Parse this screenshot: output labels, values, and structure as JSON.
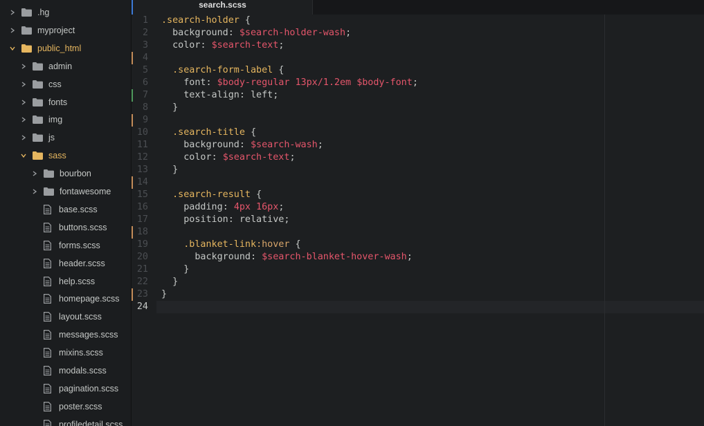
{
  "tree": {
    "items": [
      {
        "label": ".hg",
        "kind": "folder",
        "expanded": false,
        "depth": 0
      },
      {
        "label": "myproject",
        "kind": "folder",
        "expanded": false,
        "depth": 0
      },
      {
        "label": "public_html",
        "kind": "folder",
        "expanded": true,
        "depth": 0
      },
      {
        "label": "admin",
        "kind": "folder",
        "expanded": false,
        "depth": 1
      },
      {
        "label": "css",
        "kind": "folder",
        "expanded": false,
        "depth": 1
      },
      {
        "label": "fonts",
        "kind": "folder",
        "expanded": false,
        "depth": 1
      },
      {
        "label": "img",
        "kind": "folder",
        "expanded": false,
        "depth": 1
      },
      {
        "label": "js",
        "kind": "folder",
        "expanded": false,
        "depth": 1
      },
      {
        "label": "sass",
        "kind": "folder",
        "expanded": true,
        "depth": 1
      },
      {
        "label": "bourbon",
        "kind": "folder",
        "expanded": false,
        "depth": 2
      },
      {
        "label": "fontawesome",
        "kind": "folder",
        "expanded": false,
        "depth": 2
      },
      {
        "label": "base.scss",
        "kind": "file",
        "depth": 2
      },
      {
        "label": "buttons.scss",
        "kind": "file",
        "depth": 2
      },
      {
        "label": "forms.scss",
        "kind": "file",
        "depth": 2
      },
      {
        "label": "header.scss",
        "kind": "file",
        "depth": 2
      },
      {
        "label": "help.scss",
        "kind": "file",
        "depth": 2
      },
      {
        "label": "homepage.scss",
        "kind": "file",
        "depth": 2
      },
      {
        "label": "layout.scss",
        "kind": "file",
        "depth": 2
      },
      {
        "label": "messages.scss",
        "kind": "file",
        "depth": 2
      },
      {
        "label": "mixins.scss",
        "kind": "file",
        "depth": 2
      },
      {
        "label": "modals.scss",
        "kind": "file",
        "depth": 2
      },
      {
        "label": "pagination.scss",
        "kind": "file",
        "depth": 2
      },
      {
        "label": "poster.scss",
        "kind": "file",
        "depth": 2
      },
      {
        "label": "profiledetail.scss",
        "kind": "file",
        "depth": 2
      }
    ]
  },
  "tabs": {
    "active_label": "search.scss"
  },
  "editor": {
    "current_line": 24,
    "git_modified_lines": [
      4,
      9,
      14,
      18,
      23
    ],
    "git_added_lines": [
      7
    ],
    "lines": [
      [
        {
          "t": ".search-holder",
          "c": "sel"
        },
        {
          "t": " {",
          "c": "punct"
        }
      ],
      [
        {
          "t": "  background",
          "c": "prop"
        },
        {
          "t": ": ",
          "c": "punct"
        },
        {
          "t": "$search-holder-wash",
          "c": "var"
        },
        {
          "t": ";",
          "c": "punct"
        }
      ],
      [
        {
          "t": "  color",
          "c": "prop"
        },
        {
          "t": ": ",
          "c": "punct"
        },
        {
          "t": "$search-text",
          "c": "var"
        },
        {
          "t": ";",
          "c": "punct"
        }
      ],
      [],
      [
        {
          "t": "  .search-form-label",
          "c": "sel"
        },
        {
          "t": " {",
          "c": "punct"
        }
      ],
      [
        {
          "t": "    font",
          "c": "prop"
        },
        {
          "t": ": ",
          "c": "punct"
        },
        {
          "t": "$body-regular",
          "c": "var"
        },
        {
          "t": " 13px/1.2em ",
          "c": "num"
        },
        {
          "t": "$body-font",
          "c": "var"
        },
        {
          "t": ";",
          "c": "punct"
        }
      ],
      [
        {
          "t": "    text-align",
          "c": "prop"
        },
        {
          "t": ": left;",
          "c": "kw"
        }
      ],
      [
        {
          "t": "  }",
          "c": "punct"
        }
      ],
      [],
      [
        {
          "t": "  .search-title",
          "c": "sel"
        },
        {
          "t": " {",
          "c": "punct"
        }
      ],
      [
        {
          "t": "    background",
          "c": "prop"
        },
        {
          "t": ": ",
          "c": "punct"
        },
        {
          "t": "$search-wash",
          "c": "var"
        },
        {
          "t": ";",
          "c": "punct"
        }
      ],
      [
        {
          "t": "    color",
          "c": "prop"
        },
        {
          "t": ": ",
          "c": "punct"
        },
        {
          "t": "$search-text",
          "c": "var"
        },
        {
          "t": ";",
          "c": "punct"
        }
      ],
      [
        {
          "t": "  }",
          "c": "punct"
        }
      ],
      [],
      [
        {
          "t": "  .search-result",
          "c": "sel"
        },
        {
          "t": " {",
          "c": "punct"
        }
      ],
      [
        {
          "t": "    padding",
          "c": "prop"
        },
        {
          "t": ": ",
          "c": "punct"
        },
        {
          "t": "4px 16px",
          "c": "num"
        },
        {
          "t": ";",
          "c": "punct"
        }
      ],
      [
        {
          "t": "    position",
          "c": "prop"
        },
        {
          "t": ": relative;",
          "c": "kw"
        }
      ],
      [],
      [
        {
          "t": "    .blanket-link",
          "c": "sel"
        },
        {
          "t": ":hover",
          "c": "ps"
        },
        {
          "t": " {",
          "c": "punct"
        }
      ],
      [
        {
          "t": "      background",
          "c": "prop"
        },
        {
          "t": ": ",
          "c": "punct"
        },
        {
          "t": "$search-blanket-hover-wash",
          "c": "var"
        },
        {
          "t": ";",
          "c": "punct"
        }
      ],
      [
        {
          "t": "    }",
          "c": "punct"
        }
      ],
      [
        {
          "t": "  }",
          "c": "punct"
        }
      ],
      [
        {
          "t": "}",
          "c": "punct"
        }
      ],
      []
    ]
  },
  "colors": {
    "folder_open": "#e6b65f",
    "accent": "#3d7bd9",
    "git_modified": "#c48d5a",
    "git_added": "#4f9a5d"
  }
}
